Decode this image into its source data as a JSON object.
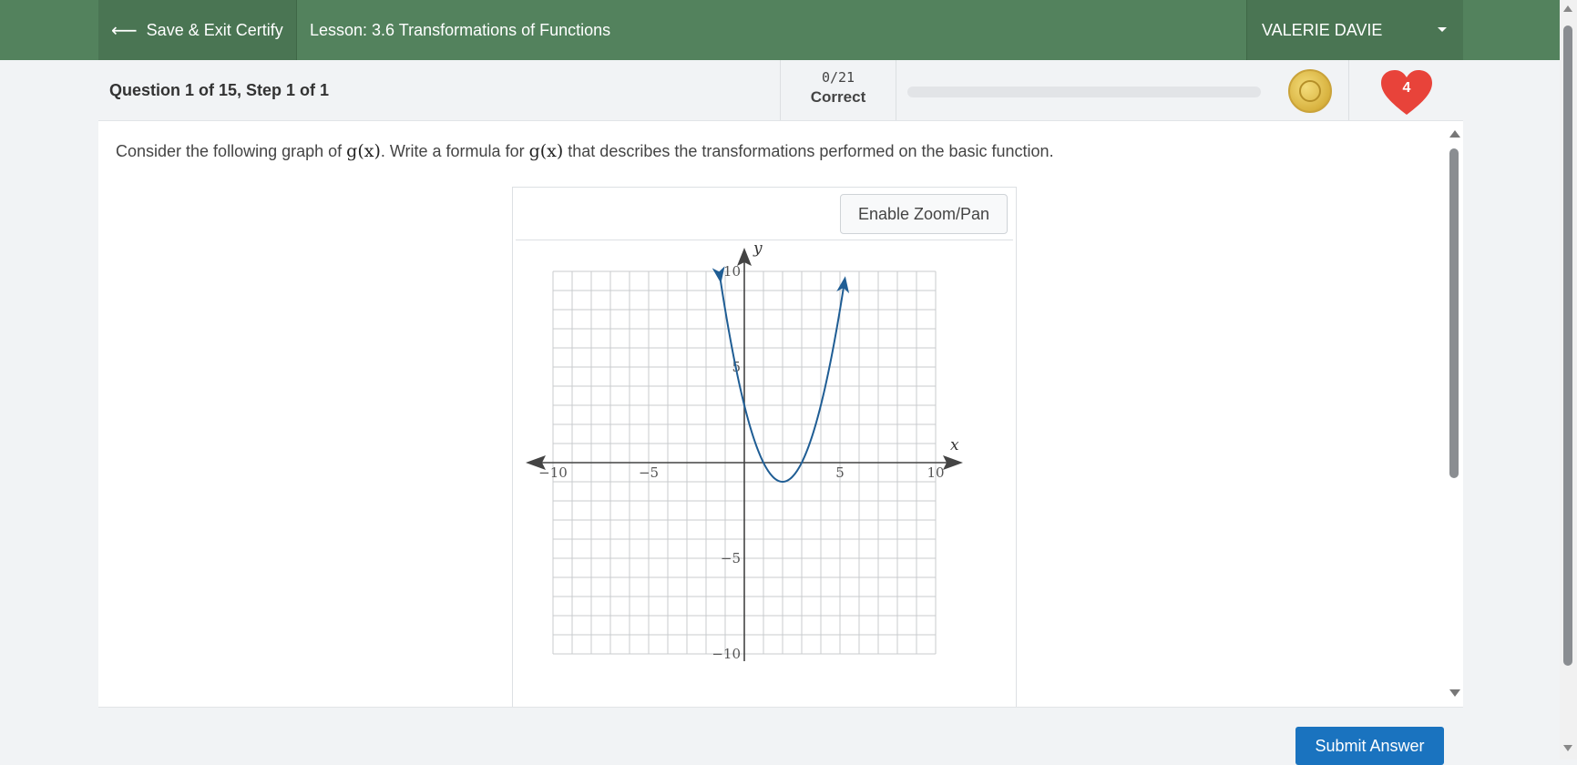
{
  "header": {
    "save_exit_label": "Save & Exit Certify",
    "lesson_title": "Lesson: 3.6 Transformations of Functions",
    "user_name": "VALERIE DAVIE"
  },
  "question_bar": {
    "question_label": "Question 1 of 15, Step 1 of 1",
    "score": "0/21",
    "score_label": "Correct",
    "progress_fraction": 0,
    "hearts": "4"
  },
  "question": {
    "prompt_part1": "Consider the following graph of ",
    "math1": "g(x)",
    "prompt_part2": ". Write a formula for ",
    "math2": "g(x)",
    "prompt_part3": " that describes the transformations performed on the basic function."
  },
  "graph": {
    "zoom_button_label": "Enable Zoom/Pan"
  },
  "chart_data": {
    "type": "line",
    "xlabel": "x",
    "ylabel": "y",
    "xlim": [
      -10,
      10
    ],
    "ylim": [
      -10,
      10
    ],
    "grid": true,
    "x_tick_labels": [
      "−10",
      "−5",
      "5",
      "10"
    ],
    "y_tick_labels": [
      "10",
      "5",
      "−5",
      "−10"
    ],
    "x_tick_values": [
      -10,
      -5,
      5,
      10
    ],
    "y_tick_values": [
      10,
      5,
      -5,
      -10
    ],
    "series": [
      {
        "curve": "parabola",
        "vertex": [
          2,
          -1
        ],
        "a": 1,
        "x_range": [
          -1.25,
          5.25
        ],
        "color": "#1f5d94",
        "arrows_at_ends": true
      }
    ]
  },
  "footer": {
    "submit_label": "Submit Answer"
  },
  "colors": {
    "header_green": "#53825d",
    "submit_blue": "#1a73bf",
    "heart_red": "#e8433a"
  }
}
